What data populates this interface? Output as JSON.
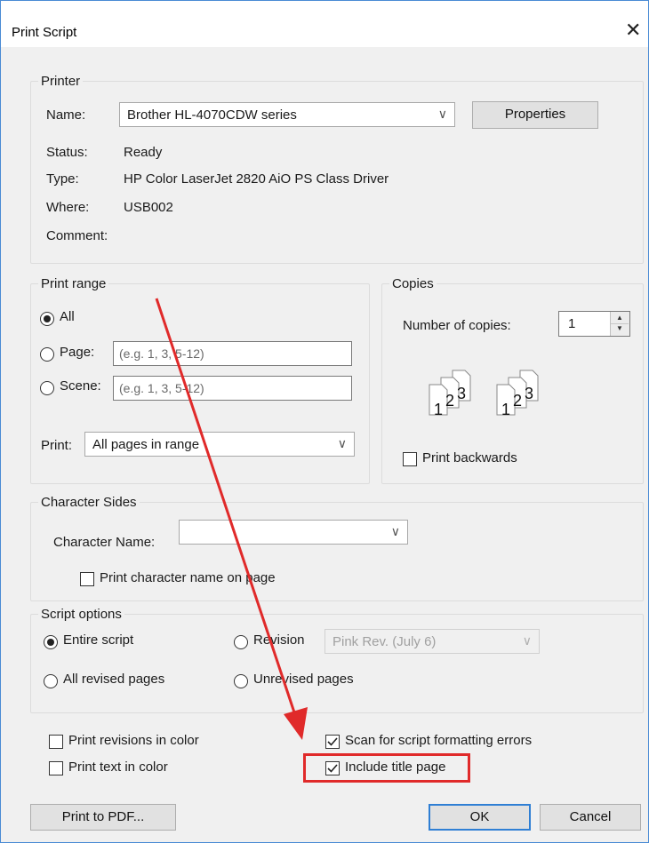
{
  "dialog": {
    "title": "Print Script"
  },
  "printer": {
    "group_label": "Printer",
    "name_label": "Name:",
    "name_value": "Brother HL-4070CDW series",
    "properties_label": "Properties",
    "status_label": "Status:",
    "status_value": "Ready",
    "type_label": "Type:",
    "type_value": "HP Color LaserJet 2820 AiO PS Class Driver",
    "where_label": "Where:",
    "where_value": "USB002",
    "comment_label": "Comment:"
  },
  "print_range": {
    "group_label": "Print range",
    "all_label": "All",
    "page_label": "Page:",
    "page_placeholder": "(e.g. 1, 3, 5-12)",
    "scene_label": "Scene:",
    "scene_placeholder": "(e.g. 1, 3, 5-12)",
    "print_label": "Print:",
    "print_value": "All pages in range",
    "selected": "All"
  },
  "copies": {
    "group_label": "Copies",
    "number_label": "Number of copies:",
    "number_value": "1",
    "collate_icon_numbers": [
      "1",
      "2",
      "3"
    ],
    "print_backwards_label": "Print backwards",
    "print_backwards_checked": false
  },
  "character_sides": {
    "group_label": "Character Sides",
    "character_name_label": "Character Name:",
    "character_name_value": "",
    "print_name_label": "Print character name on page",
    "print_name_checked": false
  },
  "script_options": {
    "group_label": "Script options",
    "entire_label": "Entire script",
    "revision_label": "Revision",
    "revision_value": "Pink Rev. (July 6)",
    "all_revised_label": "All revised pages",
    "unrevised_label": "Unrevised pages",
    "selected": "Entire script"
  },
  "options": {
    "print_revisions_color_label": "Print revisions in color",
    "print_revisions_color_checked": false,
    "print_text_color_label": "Print text in color",
    "print_text_color_checked": false,
    "scan_errors_label": "Scan for script formatting errors",
    "scan_errors_checked": true,
    "include_title_label": "Include title page",
    "include_title_checked": true
  },
  "buttons": {
    "print_pdf": "Print to PDF...",
    "ok": "OK",
    "cancel": "Cancel"
  },
  "annotation": {
    "arrow_color": "#e02a2a",
    "box_color": "#e02a2a"
  },
  "colors": {
    "accent": "#2f7fd4",
    "window_bg": "#f0f0f0"
  }
}
